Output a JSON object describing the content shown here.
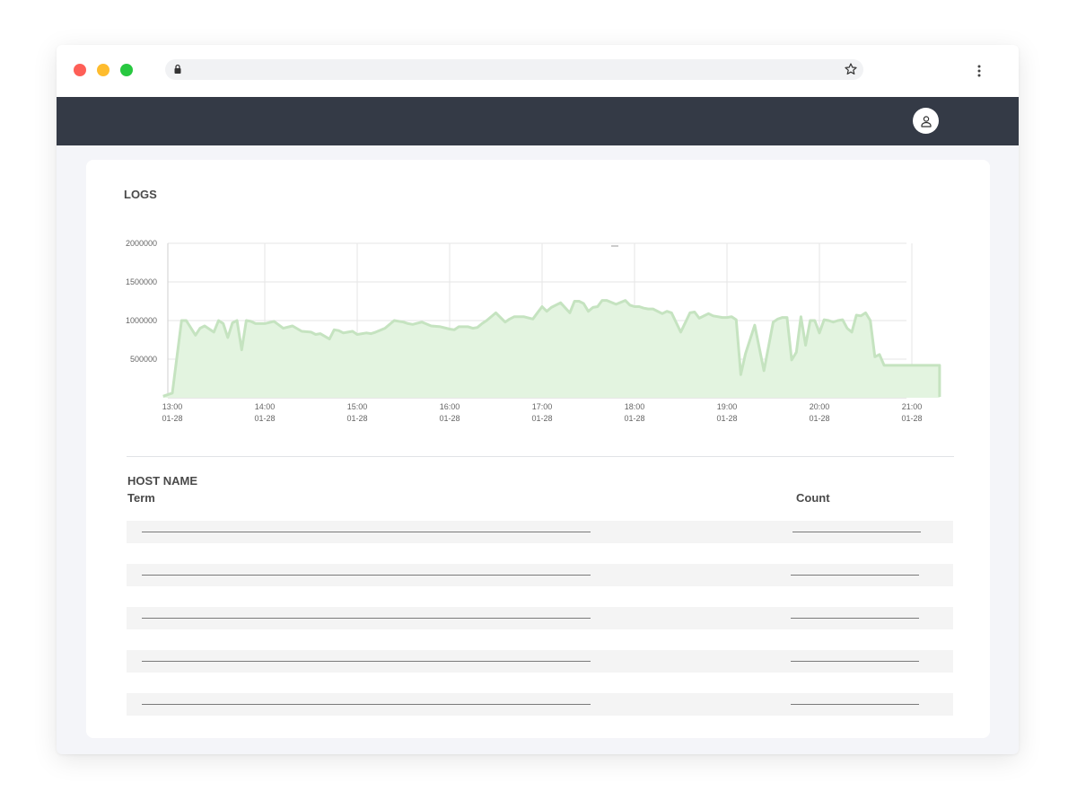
{
  "browser": {
    "traffic_lights": [
      "close",
      "minimize",
      "maximize"
    ],
    "address_bar": {
      "url": "",
      "icons": [
        "lock-icon",
        "star-icon"
      ]
    },
    "menu_icon": "kebab-menu-icon"
  },
  "navbar": {
    "user_icon": "user-icon",
    "background": "#343a46"
  },
  "logs": {
    "title": "LOGS",
    "chart_data": {
      "type": "area",
      "title": "LOGS",
      "xlabel": "",
      "ylabel": "",
      "ylim": [
        0,
        2000000
      ],
      "yticks": [
        "2000000",
        "1500000",
        "1000000",
        "500000"
      ],
      "xticks": [
        {
          "time": "13:00",
          "date": "01-28"
        },
        {
          "time": "14:00",
          "date": "01-28"
        },
        {
          "time": "15:00",
          "date": "01-28"
        },
        {
          "time": "16:00",
          "date": "01-28"
        },
        {
          "time": "17:00",
          "date": "01-28"
        },
        {
          "time": "18:00",
          "date": "01-28"
        },
        {
          "time": "19:00",
          "date": "01-28"
        },
        {
          "time": "20:00",
          "date": "01-28"
        },
        {
          "time": "21:00",
          "date": "01-28"
        }
      ],
      "color": "#c5e3c0",
      "fill": "#e3f4e0",
      "grid": true,
      "series": [
        {
          "x": [
            12.9,
            13.0,
            13.1,
            13.15,
            13.25,
            13.3,
            13.35,
            13.45,
            13.5,
            13.55,
            13.6,
            13.65,
            13.7,
            13.75,
            13.8,
            13.85,
            13.9,
            14.0,
            14.1,
            14.2,
            14.3,
            14.4,
            14.5,
            14.55,
            14.6,
            14.7,
            14.75,
            14.8,
            14.85,
            14.9,
            14.95,
            15.0,
            15.1,
            15.15,
            15.2,
            15.3,
            15.4,
            15.5,
            15.55,
            15.6,
            15.7,
            15.8,
            15.9,
            16.0,
            16.05,
            16.1,
            16.2,
            16.25,
            16.3,
            16.35,
            16.4,
            16.5,
            16.6,
            16.65,
            16.7,
            16.8,
            16.9,
            16.95,
            17.0,
            17.05,
            17.1,
            17.2,
            17.3,
            17.35,
            17.4,
            17.45,
            17.5,
            17.55,
            17.6,
            17.65,
            17.7,
            17.8,
            17.9,
            17.95,
            18.0,
            18.05,
            18.1,
            18.15,
            18.2,
            18.3,
            18.35,
            18.4,
            18.5,
            18.6,
            18.65,
            18.7,
            18.8,
            18.85,
            18.9,
            18.95,
            19.0,
            19.05,
            19.1,
            19.15,
            19.2,
            19.3,
            19.4,
            19.5,
            19.55,
            19.6,
            19.65,
            19.7,
            19.75,
            19.8,
            19.85,
            19.9,
            19.95,
            20.0,
            20.05,
            20.1,
            20.15,
            20.2,
            20.25,
            20.3,
            20.35,
            20.4,
            20.45,
            20.5,
            20.55,
            20.6,
            20.65,
            20.7,
            20.75,
            20.8,
            20.9,
            21.0,
            21.05,
            21.1,
            21.15,
            21.2,
            21.25,
            21.3
          ],
          "y": [
            20000,
            60000,
            1000000,
            1000000,
            810000,
            900000,
            930000,
            850000,
            1000000,
            960000,
            780000,
            970000,
            1000000,
            620000,
            1000000,
            990000,
            960000,
            960000,
            990000,
            900000,
            930000,
            860000,
            850000,
            820000,
            830000,
            760000,
            880000,
            870000,
            840000,
            850000,
            860000,
            820000,
            840000,
            830000,
            850000,
            900000,
            1000000,
            980000,
            960000,
            950000,
            980000,
            930000,
            920000,
            890000,
            880000,
            920000,
            920000,
            900000,
            910000,
            960000,
            1000000,
            1100000,
            980000,
            1020000,
            1050000,
            1050000,
            1020000,
            1100000,
            1180000,
            1120000,
            1170000,
            1230000,
            1100000,
            1250000,
            1250000,
            1220000,
            1120000,
            1170000,
            1180000,
            1260000,
            1260000,
            1210000,
            1260000,
            1200000,
            1180000,
            1180000,
            1160000,
            1150000,
            1150000,
            1090000,
            1120000,
            1100000,
            850000,
            1100000,
            1110000,
            1030000,
            1090000,
            1060000,
            1050000,
            1040000,
            1040000,
            1050000,
            1010000,
            300000,
            570000,
            940000,
            350000,
            980000,
            1020000,
            1040000,
            1040000,
            490000,
            590000,
            1050000,
            680000,
            1000000,
            1000000,
            840000,
            1010000,
            1000000,
            980000,
            1000000,
            1010000,
            900000,
            850000,
            1070000,
            1060000,
            1100000,
            1000000,
            530000,
            560000,
            420000,
            420000,
            420000,
            420000,
            420000,
            420000,
            420000,
            420000,
            420000,
            420000,
            420000,
            420000,
            420000
          ],
          "name": ""
        }
      ]
    }
  },
  "host": {
    "title": "HOST NAME",
    "columns": {
      "term": "Term",
      "count": "Count"
    },
    "rows": 5
  }
}
